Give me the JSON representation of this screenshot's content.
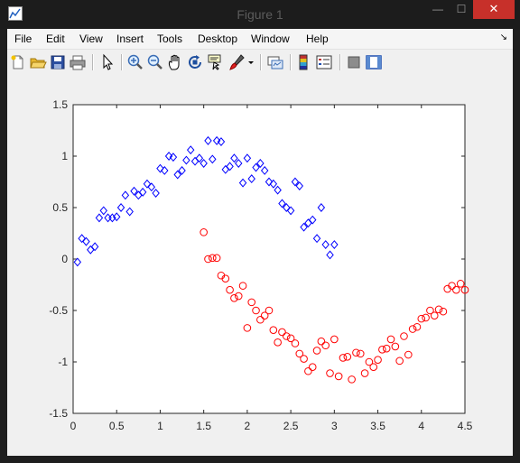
{
  "window": {
    "title": "Figure 1",
    "minimize_glyph": "—",
    "maximize_glyph": "☐",
    "close_glyph": "✕"
  },
  "menu": {
    "items": [
      "File",
      "Edit",
      "View",
      "Insert",
      "Tools",
      "Desktop",
      "Window",
      "Help"
    ],
    "dock_glyph": "↘"
  },
  "toolbar": {
    "icons": [
      "new-figure-icon",
      "open-file-icon",
      "save-icon",
      "print-icon",
      "edit-plot-icon",
      "zoom-in-icon",
      "zoom-out-icon",
      "pan-icon",
      "rotate-3d-icon",
      "data-cursor-icon",
      "brush-icon",
      "brush-dropdown-icon",
      "link-plot-icon",
      "colorbar-icon",
      "legend-icon",
      "hide-plot-tools-icon",
      "show-plot-tools-icon"
    ]
  },
  "colors": {
    "series_blue": "#0000ff",
    "series_red": "#ff0000",
    "plot_bg": "#ffffff",
    "figure_bg": "#f0f0f0",
    "close_red": "#c7302a"
  },
  "chart_data": {
    "type": "scatter",
    "title": "",
    "xlabel": "",
    "ylabel": "",
    "xlim": [
      0,
      4.5
    ],
    "ylim": [
      -1.5,
      1.5
    ],
    "xticks": [
      0,
      0.5,
      1,
      1.5,
      2,
      2.5,
      3,
      3.5,
      4,
      4.5
    ],
    "yticks": [
      -1.5,
      -1,
      -0.5,
      0,
      0.5,
      1,
      1.5
    ],
    "xtick_labels": [
      "0",
      "0.5",
      "1",
      "1.5",
      "2",
      "2.5",
      "3",
      "3.5",
      "4",
      "4.5"
    ],
    "ytick_labels": [
      "-1.5",
      "-1",
      "-0.5",
      "0",
      "0.5",
      "1",
      "1.5"
    ],
    "grid": false,
    "series": [
      {
        "marker": "diamond",
        "color": "#0000ff",
        "x": [
          0.05,
          0.1,
          0.15,
          0.2,
          0.25,
          0.3,
          0.35,
          0.4,
          0.45,
          0.5,
          0.55,
          0.6,
          0.65,
          0.7,
          0.75,
          0.8,
          0.85,
          0.9,
          0.95,
          1.0,
          1.05,
          1.1,
          1.15,
          1.2,
          1.25,
          1.3,
          1.35,
          1.4,
          1.45,
          1.5,
          1.55,
          1.6,
          1.65,
          1.7,
          1.75,
          1.8,
          1.85,
          1.9,
          1.95,
          2.0,
          2.05,
          2.1,
          2.15,
          2.2,
          2.25,
          2.3,
          2.35,
          2.4,
          2.45,
          2.5,
          2.55,
          2.6,
          2.65,
          2.7,
          2.75,
          2.8,
          2.85,
          2.9,
          2.95,
          3.0
        ],
        "y": [
          -0.03,
          0.2,
          0.17,
          0.09,
          0.12,
          0.4,
          0.47,
          0.4,
          0.4,
          0.41,
          0.5,
          0.62,
          0.46,
          0.66,
          0.62,
          0.65,
          0.73,
          0.7,
          0.64,
          0.88,
          0.86,
          1.0,
          0.99,
          0.82,
          0.86,
          0.96,
          1.06,
          0.95,
          0.98,
          0.93,
          1.15,
          0.97,
          1.15,
          1.14,
          0.87,
          0.9,
          0.98,
          0.93,
          0.74,
          0.98,
          0.78,
          0.89,
          0.93,
          0.86,
          0.75,
          0.73,
          0.67,
          0.54,
          0.5,
          0.47,
          0.75,
          0.71,
          0.31,
          0.35,
          0.38,
          0.2,
          0.5,
          0.14,
          0.04,
          0.14
        ]
      },
      {
        "marker": "circle",
        "color": "#ff0000",
        "x": [
          1.5,
          1.55,
          1.6,
          1.65,
          1.7,
          1.75,
          1.8,
          1.85,
          1.9,
          1.95,
          2.0,
          2.05,
          2.1,
          2.15,
          2.2,
          2.25,
          2.3,
          2.35,
          2.4,
          2.45,
          2.5,
          2.55,
          2.6,
          2.65,
          2.7,
          2.75,
          2.8,
          2.85,
          2.9,
          2.95,
          3.0,
          3.05,
          3.1,
          3.15,
          3.2,
          3.25,
          3.3,
          3.35,
          3.4,
          3.45,
          3.5,
          3.55,
          3.6,
          3.65,
          3.7,
          3.75,
          3.8,
          3.85,
          3.9,
          3.95,
          4.0,
          4.05,
          4.1,
          4.15,
          4.2,
          4.25,
          4.3,
          4.35,
          4.4,
          4.45,
          4.5
        ],
        "y": [
          0.26,
          0.0,
          0.01,
          0.01,
          -0.16,
          -0.19,
          -0.3,
          -0.38,
          -0.36,
          -0.26,
          -0.67,
          -0.42,
          -0.5,
          -0.59,
          -0.55,
          -0.5,
          -0.69,
          -0.81,
          -0.71,
          -0.75,
          -0.77,
          -0.82,
          -0.92,
          -0.97,
          -1.09,
          -1.05,
          -0.89,
          -0.8,
          -0.84,
          -1.11,
          -0.78,
          -1.14,
          -0.96,
          -0.95,
          -1.17,
          -0.91,
          -0.92,
          -1.11,
          -1.0,
          -1.05,
          -0.98,
          -0.88,
          -0.87,
          -0.78,
          -0.85,
          -0.99,
          -0.75,
          -0.93,
          -0.68,
          -0.66,
          -0.58,
          -0.57,
          -0.5,
          -0.55,
          -0.49,
          -0.51,
          -0.29,
          -0.26,
          -0.3,
          -0.24,
          -0.3
        ]
      }
    ]
  }
}
